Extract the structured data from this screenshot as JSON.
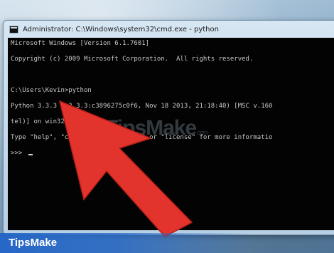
{
  "window": {
    "title": "Administrator: C:\\Windows\\system32\\cmd.exe - python",
    "app_icon": "cmd-icon"
  },
  "console": {
    "lines": [
      "Microsoft Windows [Version 6.1.7601]",
      "Copyright (c) 2009 Microsoft Corporation.  All rights reserved.",
      "",
      "C:\\Users\\Kevin>python",
      "Python 3.3.3 (v3.3.3:c3896275c0f6, Nov 18 2013, 21:18:40) [MSC v.160",
      "tel)] on win32",
      "Type \"help\", \"copyright\", \"credits\" or \"license\" for more informatio",
      ">>> "
    ],
    "text_color": "#c8c8c8",
    "background": "#030303"
  },
  "overlay": {
    "arrow_color": "#e2342c",
    "arrow_icon": "red-pointer-arrow-icon",
    "watermark": "TipsMake",
    "watermark_suffix": ".com"
  },
  "brand": {
    "label": "TipsMake",
    "color": "#2164c8"
  }
}
